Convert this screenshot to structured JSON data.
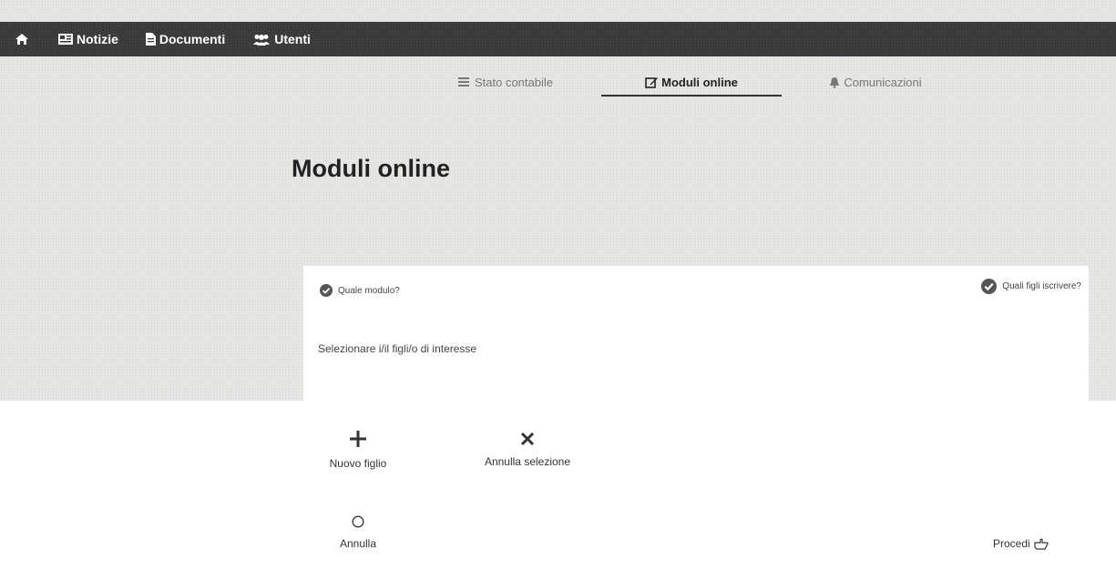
{
  "nav": {
    "items": [
      {
        "label": "Notizie",
        "icon": "newspaper-icon"
      },
      {
        "label": "Documenti",
        "icon": "file-icon"
      },
      {
        "label": "Utenti",
        "icon": "users-icon"
      }
    ]
  },
  "tabs": [
    {
      "label": "Stato contabile",
      "icon": "ledger-icon"
    },
    {
      "label": "Moduli online",
      "icon": "edit-icon",
      "active": true
    },
    {
      "label": "Comunicazioni",
      "icon": "bell-icon"
    }
  ],
  "page": {
    "title": "Moduli online"
  },
  "wizard": {
    "step1": "Quale modulo?",
    "step2": "Quali figli iscrivere?",
    "instruction": "Selezionare i/il figli/o di interesse"
  },
  "actions": {
    "new_child": "Nuovo figlio",
    "cancel_selection": "Annulla selezione",
    "cancel": "Annulla",
    "proceed": "Procedi"
  },
  "colors": {
    "topbar": "#3a3a3a",
    "background": "#e9e9e6",
    "active_tab_underline": "#333333"
  }
}
